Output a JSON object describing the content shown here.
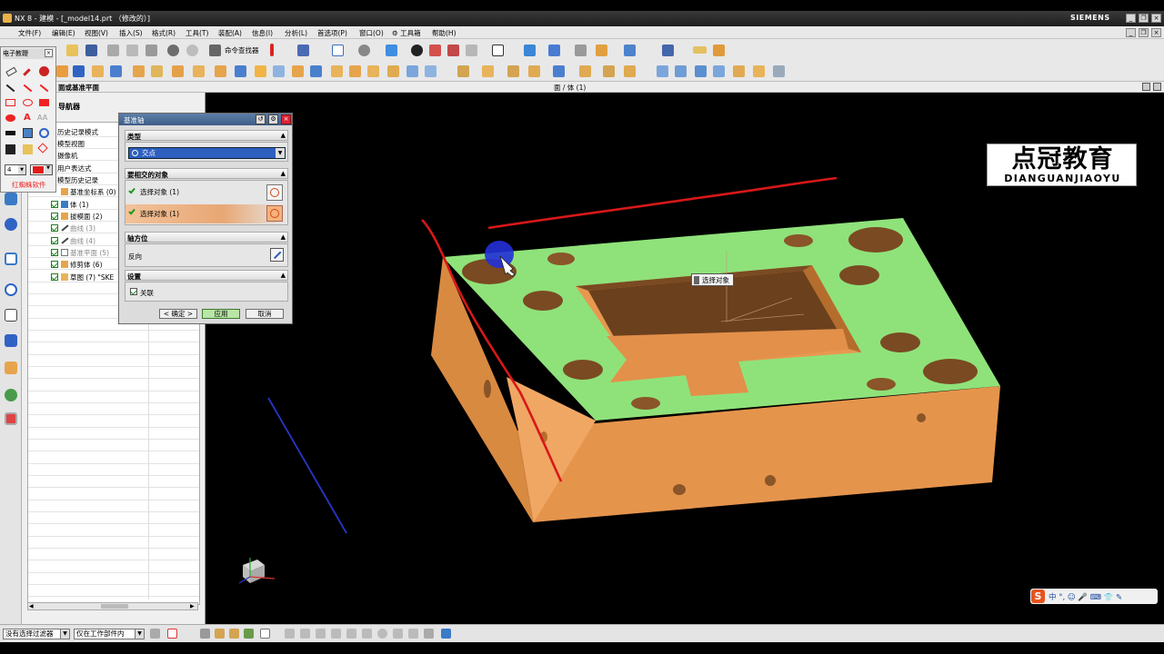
{
  "window": {
    "title": "NX 8 - 建模 - [_model14.prt （修改的）]",
    "brand": "SIEMENS"
  },
  "menu": [
    "文件(F)",
    "编辑(E)",
    "视图(V)",
    "插入(S)",
    "格式(R)",
    "工具(T)",
    "装配(A)",
    "信息(I)",
    "分析(L)",
    "首选项(P)",
    "窗口(O)",
    "⚙ 工具箱",
    "帮助(H)"
  ],
  "toolbar": {
    "command_finder": "命令查找器"
  },
  "subbar": {
    "left": "面或基准平面",
    "center": "面 / 体 (1)"
  },
  "paint_toolbar": {
    "title": "电子教鞭",
    "width_value": "4",
    "label": "红蜘蛛软件",
    "pen_color": "#e21a1a"
  },
  "navigator": {
    "title": "导航器",
    "rows": [
      {
        "text": "历史记录模式",
        "check": false
      },
      {
        "text": "模型视图",
        "check": false
      },
      {
        "text": "摄像机",
        "check": false
      },
      {
        "text": "用户表达式",
        "check": false
      },
      {
        "text": "模型历史记录",
        "check": false
      },
      {
        "text": "基准坐标系 (0)",
        "check": true
      },
      {
        "text": "体 (1)",
        "check": true
      },
      {
        "text": "拔模面 (2)",
        "check": true
      },
      {
        "text": "曲线 (3)",
        "check": true
      },
      {
        "text": "曲线 (4)",
        "check": true
      },
      {
        "text": "基准平面 (5)",
        "check": true
      },
      {
        "text": "修剪体 (6)",
        "check": true
      },
      {
        "text": "草图 (7) \"SKE",
        "check": true
      }
    ]
  },
  "dialog": {
    "title": "基准轴",
    "type_section": "类型",
    "type_value": "交点",
    "intersect_section": "要相交的对象",
    "select_object_1": "选择对象 (1)",
    "select_object_2": "选择对象 (1)",
    "axis_section": "轴方位",
    "reverse_label": "反向",
    "settings_section": "设置",
    "associative_label": "关联",
    "associative_checked": true,
    "ok_button": "< 确定 >",
    "apply_button": "应用",
    "cancel_button": "取消"
  },
  "viewport": {
    "tooltip": "选择对象",
    "part_color": "#e5944c",
    "face_color": "#8fe27a"
  },
  "logo": {
    "line1": "点冠教育",
    "line2": "DIANGUANJIAOYU"
  },
  "ime": {
    "text": "中 °, ☺ 🎤 ⌨ 👕 ✎"
  },
  "status": {
    "filter": "没有选择过滤器",
    "scope": "仅在工作部件内"
  }
}
